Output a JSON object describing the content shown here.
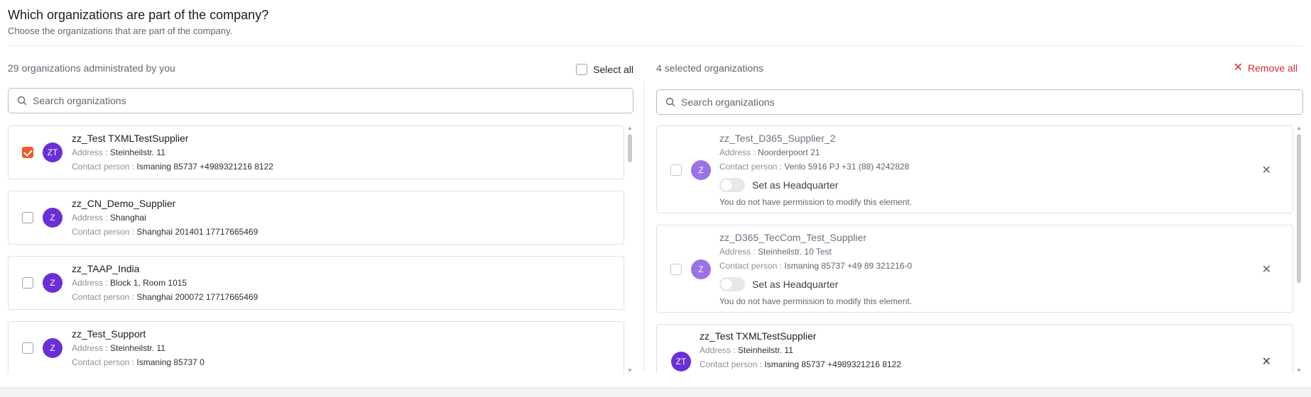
{
  "header": {
    "title": "Which organizations are part of the company?",
    "subtitle": "Choose the organizations that are part of the company."
  },
  "left": {
    "count_label": "29 organizations administrated by you",
    "select_all_label": "Select all",
    "search_placeholder": "Search organizations",
    "items": [
      {
        "initials": "ZT",
        "name": "zz_Test TXMLTestSupplier",
        "address_label": "Address :",
        "address": "Steinheilstr. 11",
        "contact_label": "Contact person :",
        "contact": "Ismaning 85737 +4989321216 8122",
        "checked": true
      },
      {
        "initials": "Z",
        "name": "zz_CN_Demo_Supplier",
        "address_label": "Address :",
        "address": "Shanghai",
        "contact_label": "Contact person :",
        "contact": "Shanghai 201401 17717665469",
        "checked": false
      },
      {
        "initials": "Z",
        "name": "zz_TAAP_India",
        "address_label": "Address :",
        "address": "Block 1, Room 1015",
        "contact_label": "Contact person :",
        "contact": "Shanghai 200072 17717665469",
        "checked": false
      },
      {
        "initials": "Z",
        "name": "zz_Test_Support",
        "address_label": "Address :",
        "address": "Steinheilstr. 11",
        "contact_label": "Contact person :",
        "contact": "Ismaning 85737 0",
        "checked": false
      }
    ]
  },
  "right": {
    "count_label": "4 selected organizations",
    "remove_all_label": "Remove all",
    "search_placeholder": "Search organizations",
    "items": [
      {
        "initials": "Z",
        "name": "zz_Test_D365_Supplier_2",
        "address_label": "Address :",
        "address": "Noorderpoort 21",
        "contact_label": "Contact person :",
        "contact": "Venlo 5916 PJ +31 (88) 4242828",
        "hq_label": "Set as Headquarter",
        "permission_note": "You do not have permission to modify this element."
      },
      {
        "initials": "Z",
        "name": "zz_D365_TecCom_Test_Supplier",
        "address_label": "Address :",
        "address": "Steinheilstr. 10 Test",
        "contact_label": "Contact person :",
        "contact": "Ismaning 85737 +49 89 321216-0",
        "hq_label": "Set as Headquarter",
        "permission_note": "You do not have permission to modify this element."
      },
      {
        "initials": "ZT",
        "name": "zz_Test TXMLTestSupplier",
        "address_label": "Address :",
        "address": "Steinheilstr. 11",
        "contact_label": "Contact person :",
        "contact": "Ismaning 85737 +4989321216 8122"
      }
    ]
  },
  "icons": {
    "search": "search-icon",
    "close": "close-icon",
    "check": "check-icon"
  },
  "colors": {
    "accent": "#f05a28",
    "avatar": "#6a2fd6",
    "danger": "#d9282f"
  }
}
